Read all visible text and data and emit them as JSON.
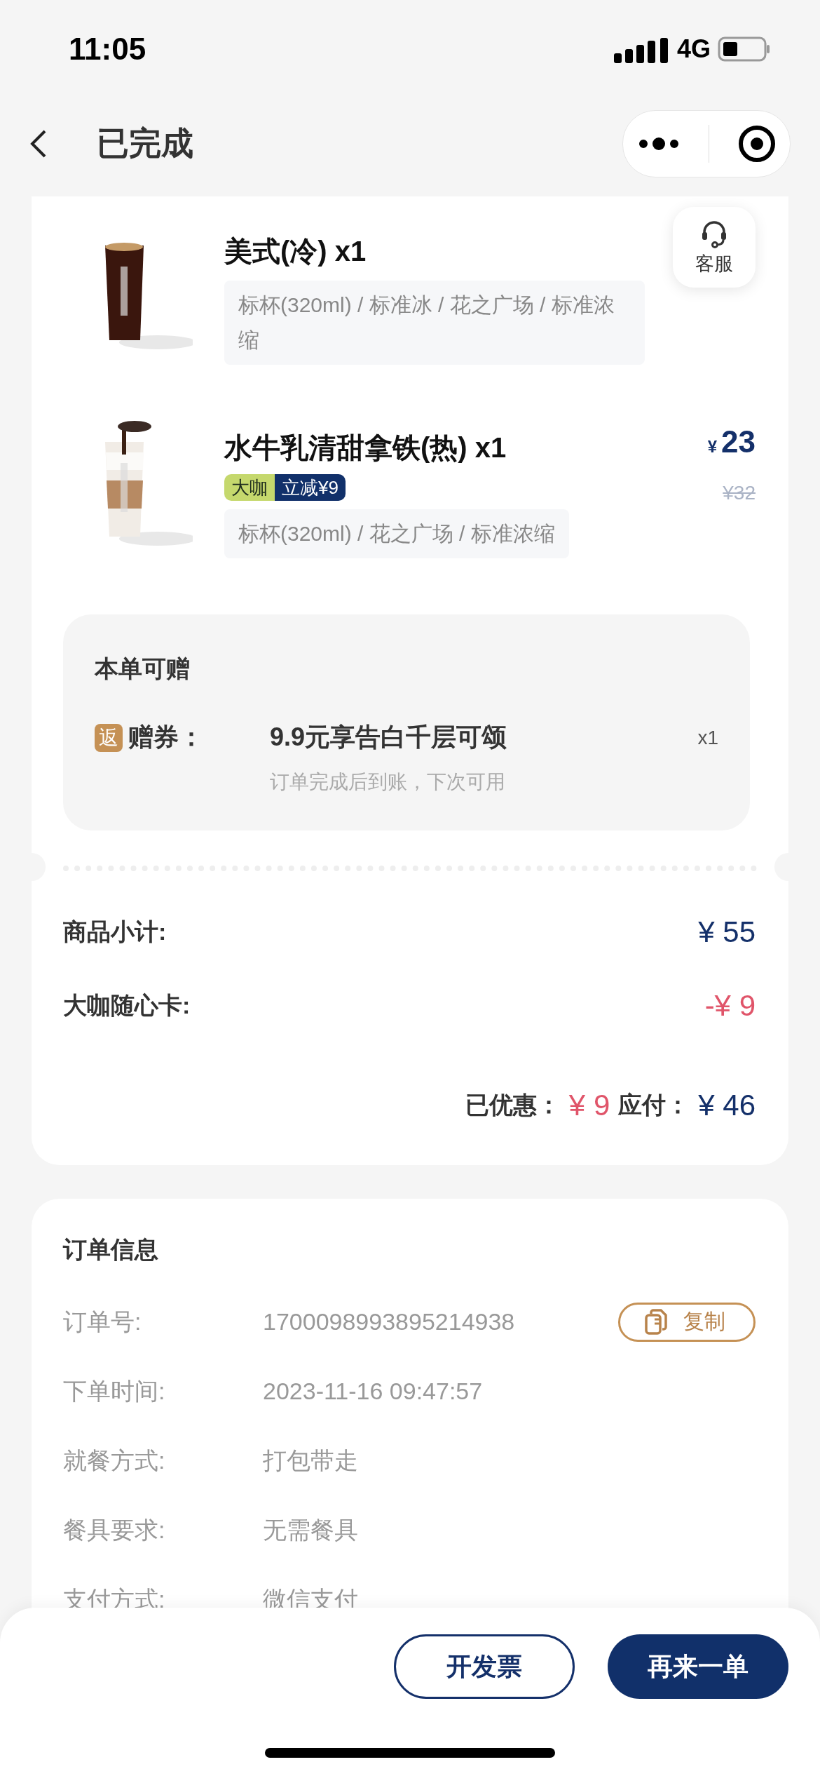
{
  "status_bar": {
    "time": "11:05",
    "network": "4G"
  },
  "nav": {
    "title": "已完成"
  },
  "service_button": {
    "label": "客服"
  },
  "products": [
    {
      "name": "美式(冷) x1",
      "kind": "black",
      "options": "标杯(320ml) / 标准冰 / 花之广场 / 标准浓缩"
    },
    {
      "name": "水牛乳清甜拿铁(热) x1",
      "kind": "latte",
      "price_symbol": "¥",
      "price": "23",
      "original_price": "¥32",
      "tags": [
        {
          "label": "大咖",
          "kind": "level"
        },
        {
          "label": "立减¥9",
          "kind": "discount"
        }
      ],
      "options": "标杯(320ml) / 花之广场 / 标准浓缩"
    }
  ],
  "gift": {
    "title": "本单可赠",
    "badge": "返",
    "label": "赠券：",
    "name": "9.9元享告白千层可颂",
    "quantity": "x1",
    "note": "订单完成后到账，下次可用"
  },
  "summary": {
    "rows": [
      {
        "label": "商品小计:",
        "value": "¥ 55",
        "kind": "charge"
      },
      {
        "label": "大咖随心卡:",
        "value": "-¥ 9",
        "kind": "discount"
      }
    ],
    "saved_label": "已优惠：",
    "saved": "¥ 9",
    "payable_label": "应付：",
    "payable": "¥ 46"
  },
  "order_info": {
    "title": "订单信息",
    "rows": [
      {
        "label": "订单号:",
        "value": "1700098993895214938",
        "action": "复制"
      },
      {
        "label": "下单时间:",
        "value": "2023-11-16 09:47:57"
      },
      {
        "label": "就餐方式:",
        "value": "打包带走"
      },
      {
        "label": "餐具要求:",
        "value": "无需餐具"
      },
      {
        "label": "支付方式:",
        "value": "微信支付"
      }
    ]
  },
  "actions": [
    {
      "label": "开发票",
      "kind": "outline"
    },
    {
      "label": "再来一单",
      "kind": "primary"
    }
  ]
}
